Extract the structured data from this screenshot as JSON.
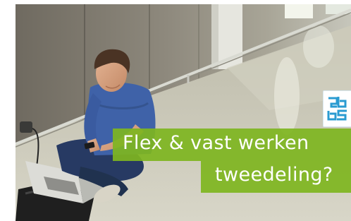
{
  "banner": {
    "headline_line1": "Flex & vast werken",
    "headline_line2": "tweedeling?",
    "accent_color": "#7eb520",
    "text_color": "#ffffff"
  },
  "logo": {
    "icon": "cbs-logo-icon",
    "color": "#2a9bd1"
  },
  "photo": {
    "subject": "man-sitting-on-floor-with-laptop-icon"
  }
}
